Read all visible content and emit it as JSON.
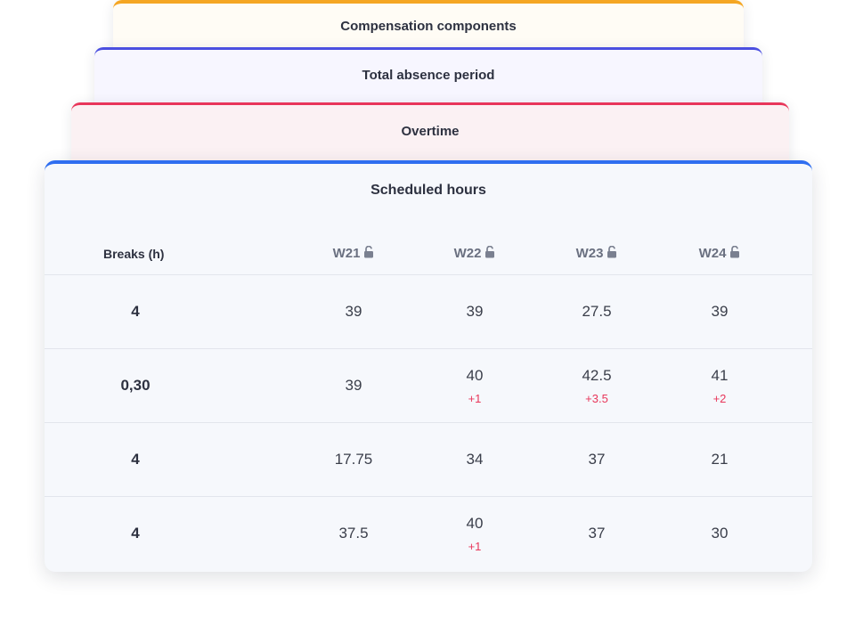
{
  "stack_cards": {
    "compensation": "Compensation components",
    "absence": "Total absence period",
    "overtime": "Overtime"
  },
  "main": {
    "title": "Scheduled hours",
    "breaks_header": "Breaks (h)",
    "weeks": [
      "W21",
      "W22",
      "W23",
      "W24"
    ],
    "rows": [
      {
        "breaks": "4",
        "cells": [
          {
            "value": "39",
            "delta": ""
          },
          {
            "value": "39",
            "delta": ""
          },
          {
            "value": "27.5",
            "delta": ""
          },
          {
            "value": "39",
            "delta": ""
          }
        ]
      },
      {
        "breaks": "0,30",
        "cells": [
          {
            "value": "39",
            "delta": ""
          },
          {
            "value": "40",
            "delta": "+1"
          },
          {
            "value": "42.5",
            "delta": "+3.5"
          },
          {
            "value": "41",
            "delta": "+2"
          }
        ]
      },
      {
        "breaks": "4",
        "cells": [
          {
            "value": "17.75",
            "delta": ""
          },
          {
            "value": "34",
            "delta": ""
          },
          {
            "value": "37",
            "delta": ""
          },
          {
            "value": "21",
            "delta": ""
          }
        ]
      },
      {
        "breaks": "4",
        "cells": [
          {
            "value": "37.5",
            "delta": ""
          },
          {
            "value": "40",
            "delta": "+1"
          },
          {
            "value": "37",
            "delta": ""
          },
          {
            "value": "30",
            "delta": ""
          }
        ]
      }
    ]
  },
  "colors": {
    "compensation_accent": "#f5a623",
    "absence_accent": "#4b4fe0",
    "overtime_accent": "#e8365a",
    "scheduled_accent": "#2f6ef0",
    "delta_text": "#e8365a"
  },
  "icons": {
    "week_lock": "unlock-icon"
  }
}
